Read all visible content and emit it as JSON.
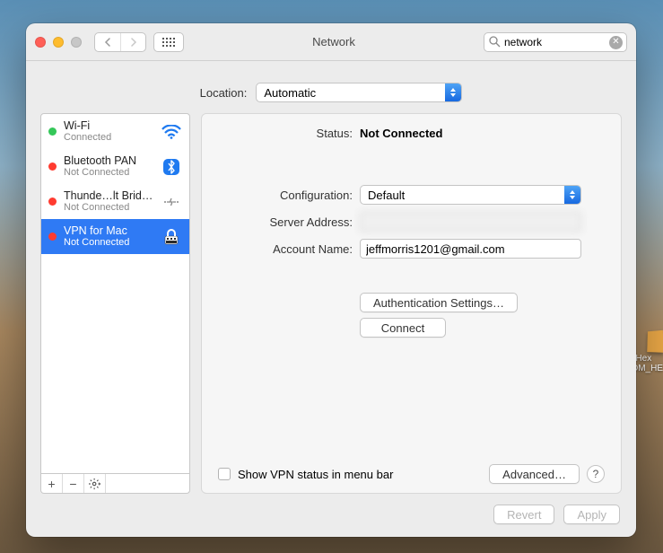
{
  "window": {
    "title": "Network"
  },
  "search": {
    "value": "network"
  },
  "location": {
    "label": "Location:",
    "value": "Automatic"
  },
  "services": [
    {
      "name": "Wi-Fi",
      "status": "Connected",
      "dot": "green",
      "icon": "wifi"
    },
    {
      "name": "Bluetooth PAN",
      "status": "Not Connected",
      "dot": "red",
      "icon": "bluetooth"
    },
    {
      "name": "Thunde…lt Bridge",
      "status": "Not Connected",
      "dot": "red",
      "icon": "thunderbolt"
    },
    {
      "name": "VPN for Mac",
      "status": "Not Connected",
      "dot": "red",
      "icon": "vpn",
      "selected": true
    }
  ],
  "detail": {
    "status_label": "Status:",
    "status_value": "Not Connected",
    "config_label": "Configuration:",
    "config_value": "Default",
    "server_label": "Server Address:",
    "server_value": "",
    "account_label": "Account Name:",
    "account_value": "jeffmorris1201@gmail.com",
    "auth_btn": "Authentication Settings…",
    "connect_btn": "Connect",
    "show_status_label": "Show VPN status in menu bar",
    "advanced_btn": "Advanced…"
  },
  "footer": {
    "revert": "Revert",
    "apply": "Apply"
  },
  "desktop": {
    "label1": "Hex",
    "label2": "MDM_HE"
  }
}
